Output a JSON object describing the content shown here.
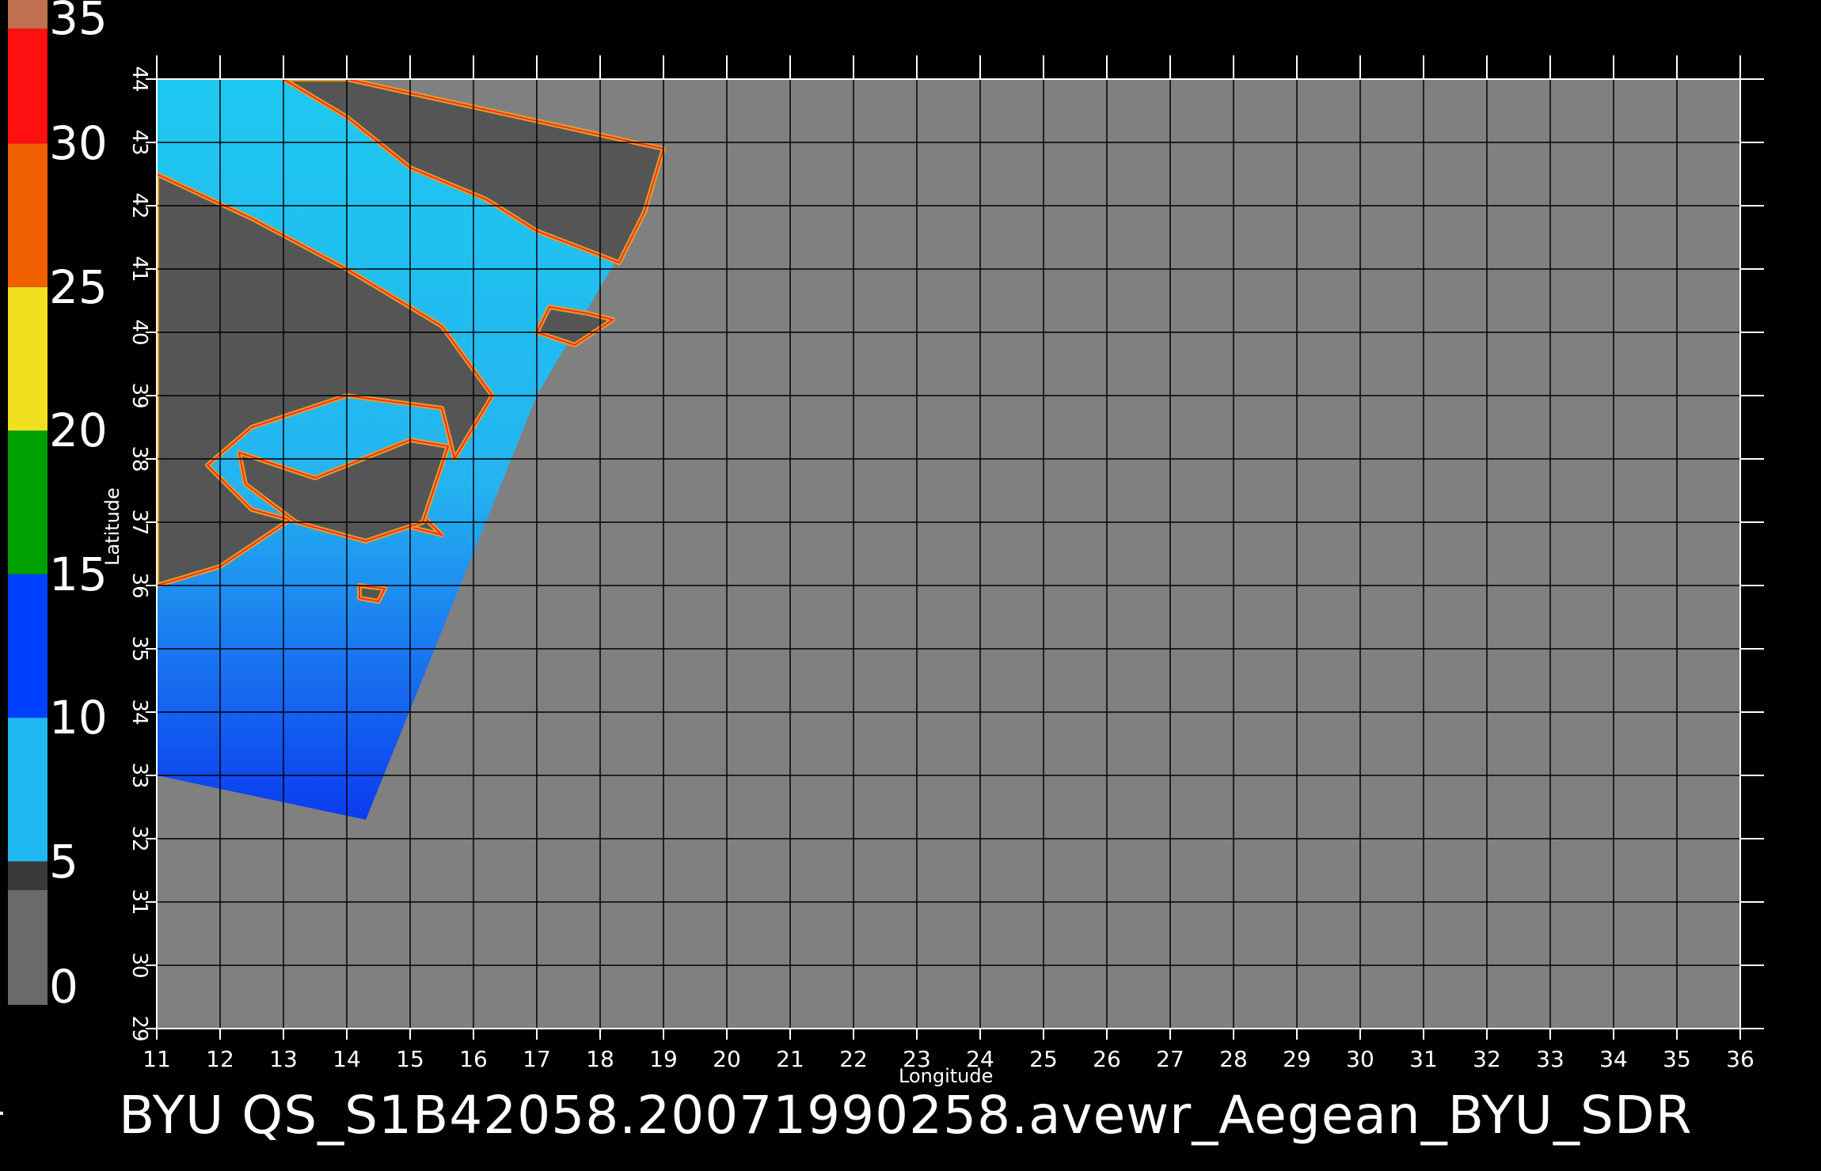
{
  "chart_data": {
    "type": "heatmap",
    "title": "",
    "xlabel": "Longitude",
    "ylabel": "Latitude",
    "xlim": [
      11,
      36
    ],
    "ylim": [
      29,
      44
    ],
    "x_ticks": [
      "11",
      "12",
      "13",
      "14",
      "15",
      "16",
      "17",
      "18",
      "19",
      "20",
      "21",
      "22",
      "23",
      "24",
      "25",
      "26",
      "27",
      "28",
      "29",
      "30",
      "31",
      "32",
      "33",
      "34",
      "35",
      "36"
    ],
    "y_ticks": [
      "29",
      "30",
      "31",
      "32",
      "33",
      "34",
      "35",
      "36",
      "37",
      "38",
      "39",
      "40",
      "41",
      "42",
      "43",
      "44"
    ],
    "grid": true,
    "background_color": "#808080",
    "land_color": "#555555",
    "swath_polygon": [
      [
        11.0,
        44.0
      ],
      [
        13.0,
        44.0
      ],
      [
        19.0,
        42.9
      ],
      [
        18.7,
        41.9
      ],
      [
        17.0,
        39.0
      ],
      [
        14.3,
        32.3
      ],
      [
        11.0,
        33.0
      ]
    ],
    "colorbar": {
      "range": [
        0,
        35
      ],
      "tick_labels": [
        "35",
        "30",
        "25",
        "20",
        "15",
        "10",
        "5",
        "0"
      ],
      "tick_values": [
        35,
        30,
        25,
        20,
        15,
        10,
        5,
        0
      ],
      "segments": [
        {
          "from": 0,
          "to": 4,
          "color": "#6a6a6a"
        },
        {
          "from": 4,
          "to": 5,
          "color": "#3a3a3a"
        },
        {
          "from": 5,
          "to": 10,
          "color": "#20b8f0"
        },
        {
          "from": 10,
          "to": 15,
          "color": "#0040ff"
        },
        {
          "from": 15,
          "to": 20,
          "color": "#00a000"
        },
        {
          "from": 20,
          "to": 25,
          "color": "#f0e020"
        },
        {
          "from": 25,
          "to": 30,
          "color": "#f06000"
        },
        {
          "from": 30,
          "to": 34,
          "color": "#ff1010"
        },
        {
          "from": 34,
          "to": 35,
          "color": "#c07050"
        }
      ]
    }
  },
  "filename": "BYU  QS_S1B42058.20071990258.avewr_Aegean_BYU_SDR"
}
